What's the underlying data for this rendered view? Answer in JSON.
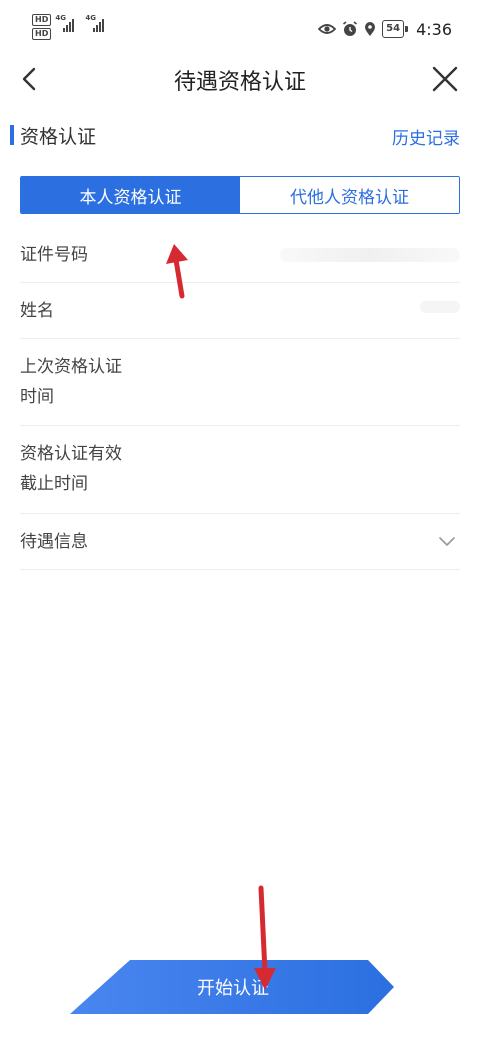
{
  "status_bar": {
    "hd_badge_1": "HD",
    "hd_badge_2": "HD",
    "network_1": "4G",
    "network_2": "4G",
    "battery": "54",
    "time": "4:36",
    "icons": [
      "eye-icon",
      "alarm-icon",
      "location-icon"
    ]
  },
  "nav": {
    "title": "待遇资格认证",
    "back_icon": "chevron-left-icon",
    "close_icon": "close-icon"
  },
  "section": {
    "title": "资格认证",
    "history_link": "历史记录",
    "accent_color": "#2b6fe0"
  },
  "tabs": [
    {
      "label": "本人资格认证",
      "active": true
    },
    {
      "label": "代他人资格认证",
      "active": false
    }
  ],
  "form": {
    "rows": [
      {
        "label_line1": "证件号码",
        "label_line2": ""
      },
      {
        "label_line1": "姓名",
        "label_line2": ""
      },
      {
        "label_line1": "上次资格认证",
        "label_line2": "时间"
      },
      {
        "label_line1": "资格认证有效",
        "label_line2": "截止时间"
      },
      {
        "label_line1": "待遇信息",
        "label_line2": ""
      }
    ]
  },
  "actions": {
    "start_button": "开始认证"
  }
}
